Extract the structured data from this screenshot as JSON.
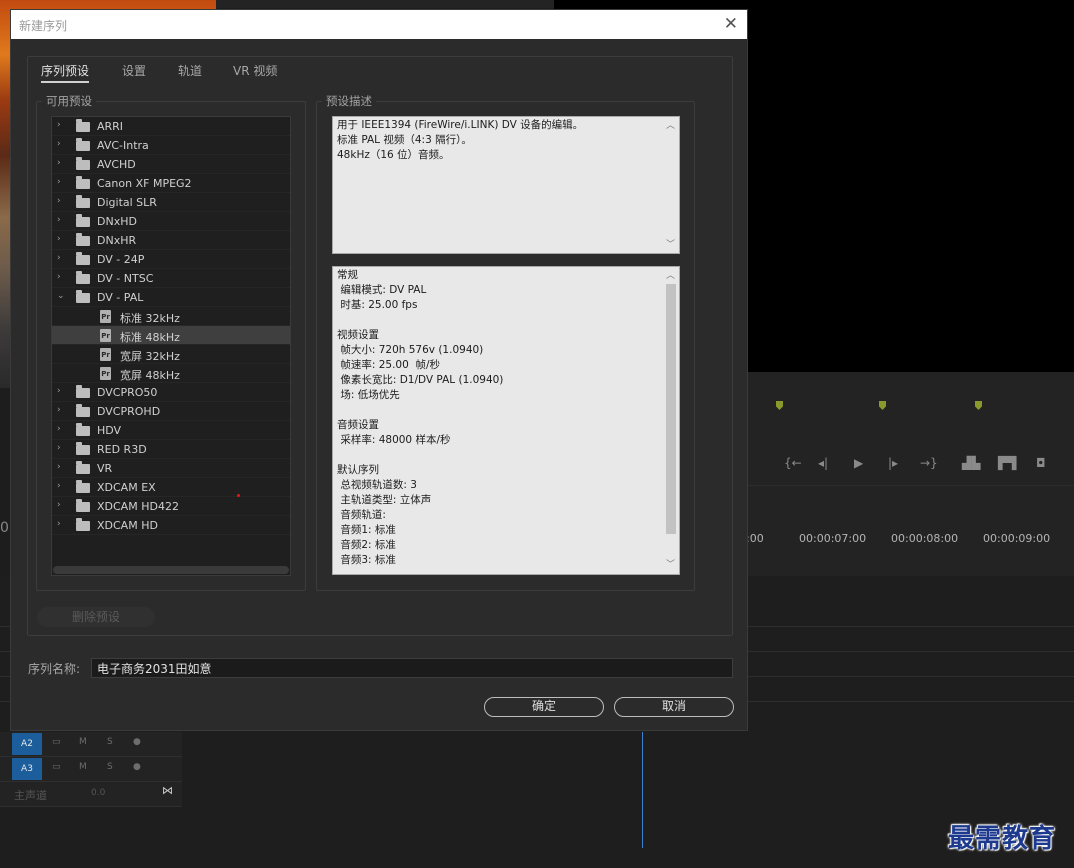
{
  "background": {
    "timecodes": [
      ":00",
      "00:00:07:00",
      "00:00:08:00",
      "00:00:09:00"
    ],
    "left_edge_text": "0:",
    "tracks": [
      {
        "id": "A2",
        "m": "M",
        "s": "S"
      },
      {
        "id": "A3",
        "m": "M",
        "s": "S"
      }
    ],
    "master": {
      "label": "主声道",
      "value": "0.0"
    }
  },
  "dialog": {
    "title": "新建序列",
    "tabs": [
      "序列预设",
      "设置",
      "轨道",
      "VR 视频"
    ],
    "active_tab": 0,
    "available_presets_label": "可用预设",
    "preset_description_label": "预设描述",
    "presets": [
      {
        "label": "ARRI",
        "expanded": false
      },
      {
        "label": "AVC-Intra",
        "expanded": false
      },
      {
        "label": "AVCHD",
        "expanded": false
      },
      {
        "label": "Canon XF MPEG2",
        "expanded": false
      },
      {
        "label": "Digital SLR",
        "expanded": false
      },
      {
        "label": "DNxHD",
        "expanded": false
      },
      {
        "label": "DNxHR",
        "expanded": false
      },
      {
        "label": "DV - 24P",
        "expanded": false
      },
      {
        "label": "DV - NTSC",
        "expanded": false
      },
      {
        "label": "DV - PAL",
        "expanded": true,
        "children": [
          {
            "label": "标准 32kHz",
            "selected": false
          },
          {
            "label": "标准 48kHz",
            "selected": true
          },
          {
            "label": "宽屏 32kHz",
            "selected": false
          },
          {
            "label": "宽屏 48kHz",
            "selected": false
          }
        ]
      },
      {
        "label": "DVCPRO50",
        "expanded": false
      },
      {
        "label": "DVCPROHD",
        "expanded": false
      },
      {
        "label": "HDV",
        "expanded": false
      },
      {
        "label": "RED R3D",
        "expanded": false
      },
      {
        "label": "VR",
        "expanded": false
      },
      {
        "label": "XDCAM EX",
        "expanded": false
      },
      {
        "label": "XDCAM HD422",
        "expanded": false
      },
      {
        "label": "XDCAM HD",
        "expanded": false
      }
    ],
    "preset_icon_text": "Pr",
    "description_lines": [
      "用于 IEEE1394 (FireWire/i.LINK) DV 设备的编辑。",
      "标准 PAL 视频（4:3 隔行）。",
      "48kHz（16 位）音频。"
    ],
    "details_lines": [
      "常规",
      " 编辑模式: DV PAL",
      " 时基: 25.00 fps",
      "",
      "视频设置",
      " 帧大小: 720h 576v (1.0940)",
      " 帧速率: 25.00  帧/秒",
      " 像素长宽比: D1/DV PAL (1.0940)",
      " 场: 低场优先",
      "",
      "音频设置",
      " 采样率: 48000 样本/秒",
      "",
      "默认序列",
      " 总视频轨道数: 3",
      " 主轨道类型: 立体声",
      " 音频轨道:",
      " 音频1: 标准",
      " 音频2: 标准",
      " 音频3: 标准"
    ],
    "delete_preset_label": "删除预设",
    "sequence_name_label": "序列名称:",
    "sequence_name_value": "电子商务2031田如意",
    "ok_label": "确定",
    "cancel_label": "取消"
  },
  "watermark": "最需教育",
  "colors": {
    "accent_track": "#1c5e9c",
    "playhead": "#3b7fd0",
    "marker": "#8a9a2a"
  }
}
